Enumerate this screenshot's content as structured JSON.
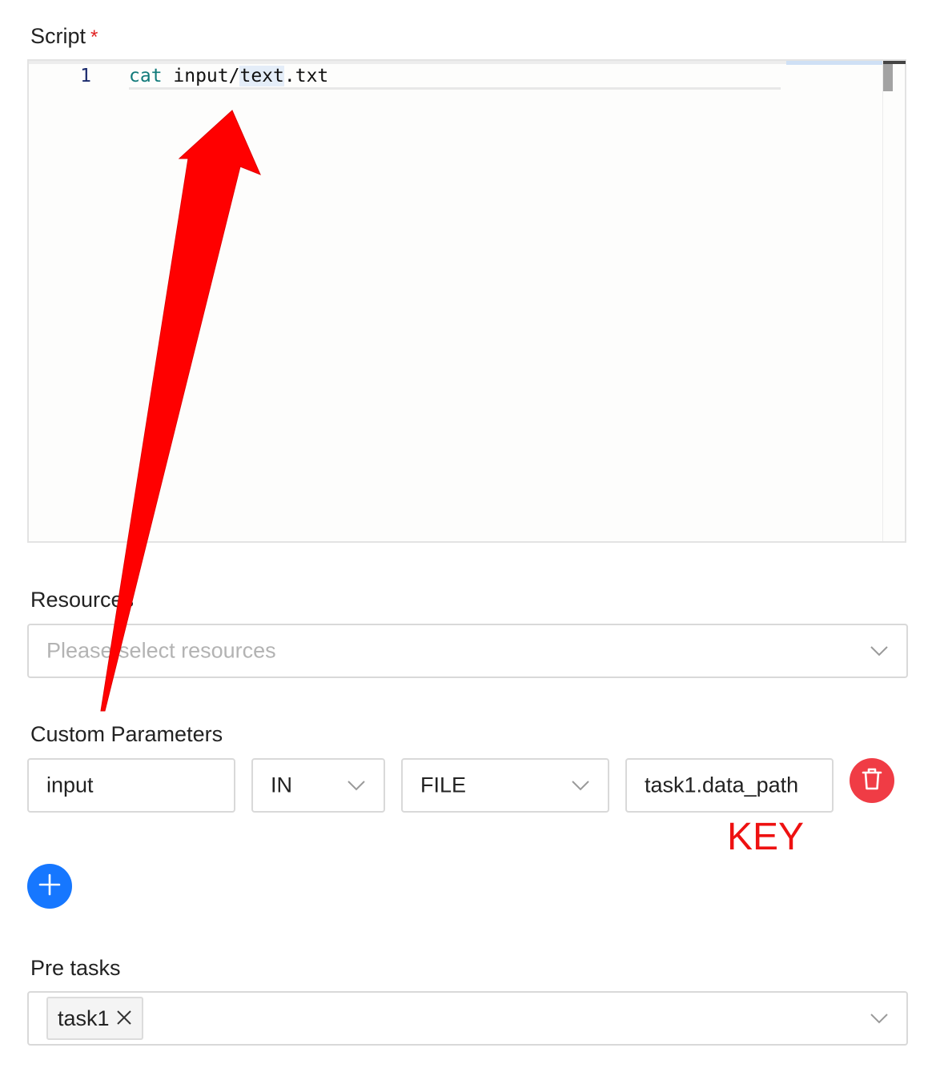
{
  "script": {
    "label": "Script",
    "required_mark": "*",
    "line_number": "1",
    "code_keyword": "cat",
    "code_rest_a": " input/",
    "code_selected": "text",
    "code_rest_b": ".txt"
  },
  "resources": {
    "label": "Resources",
    "placeholder": "Please select resources"
  },
  "custom_parameters": {
    "label": "Custom Parameters",
    "prop": "input",
    "direction": "IN",
    "type": "FILE",
    "value": "task1.data_path"
  },
  "annotation": {
    "key_label": "KEY",
    "color": "#ff0000"
  },
  "pre_tasks": {
    "label": "Pre tasks",
    "tags": [
      "task1"
    ]
  },
  "colors": {
    "primary": "#1677ff",
    "danger": "#f03c45"
  }
}
